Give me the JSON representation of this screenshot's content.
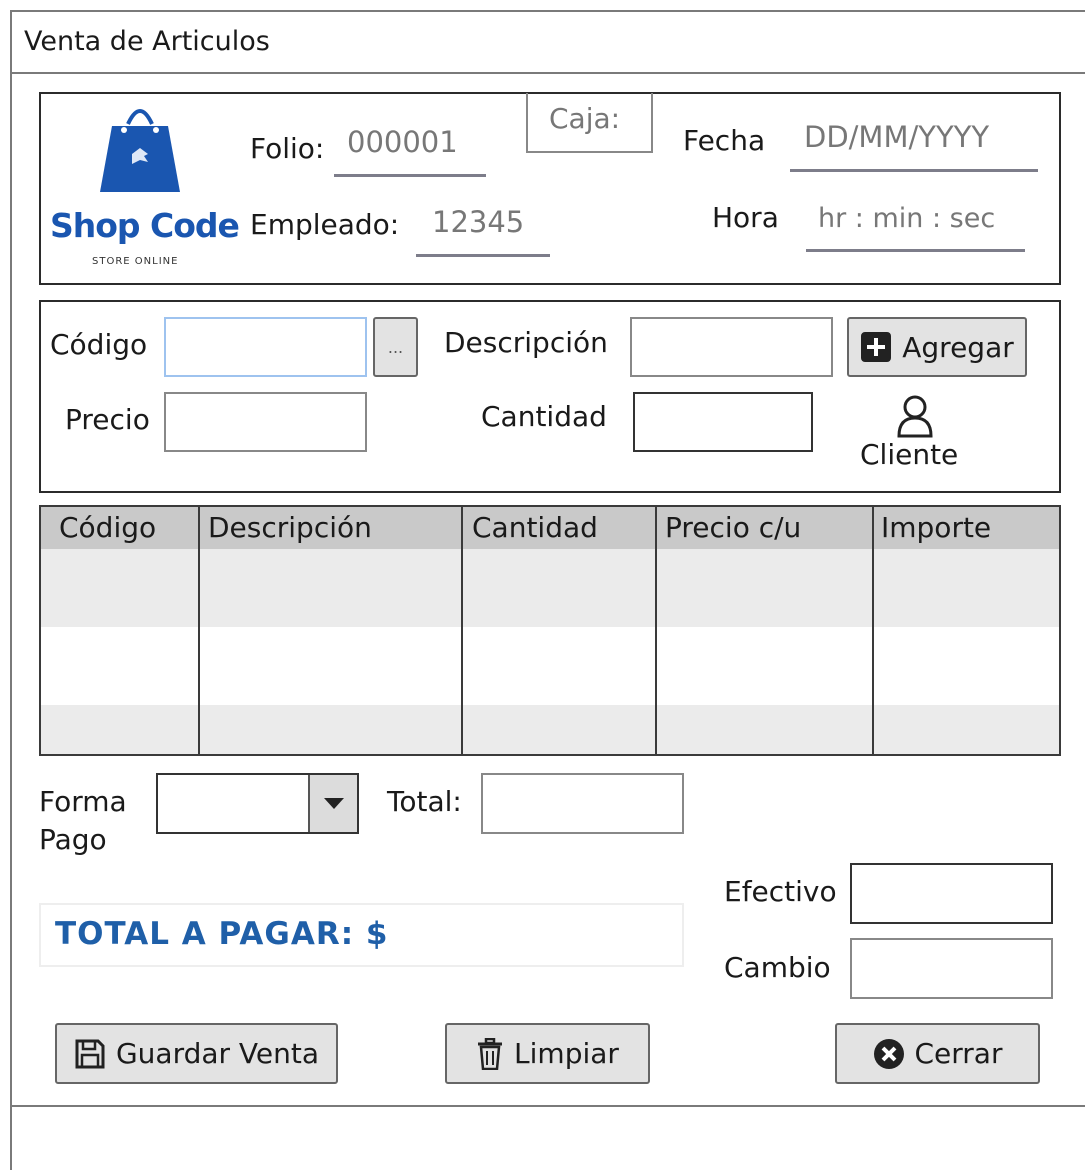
{
  "window": {
    "title": "Venta de Articulos"
  },
  "header": {
    "logo": {
      "brand": "Shop Code",
      "tagline": "STORE ONLINE"
    },
    "folio": {
      "label": "Folio:",
      "value": "000001"
    },
    "empleado": {
      "label": "Empleado:",
      "value": "12345"
    },
    "caja": {
      "label": "Caja:"
    },
    "fecha": {
      "label": "Fecha",
      "value": "DD/MM/YYYY"
    },
    "hora": {
      "label": "Hora",
      "value": "hr : min : sec"
    }
  },
  "entry": {
    "codigo_label": "Código",
    "browse_label": "...",
    "descripcion_label": "Descripción",
    "agregar_label": "Agregar",
    "precio_label": "Precio",
    "cantidad_label": "Cantidad",
    "cliente_label": "Cliente"
  },
  "table": {
    "columns": [
      "Código",
      "Descripción",
      "Cantidad",
      "Precio c/u",
      "Importe"
    ],
    "rows": []
  },
  "payment": {
    "forma_pago_label_1": "Forma",
    "forma_pago_label_2": "Pago",
    "forma_pago_value": "",
    "total_label": "Total:",
    "total_value": "",
    "total_a_pagar": "TOTAL  A PAGAR: $",
    "efectivo_label": "Efectivo",
    "cambio_label": "Cambio"
  },
  "actions": {
    "guardar_label": "Guardar Venta",
    "limpiar_label": "Limpiar",
    "cerrar_label": "Cerrar"
  },
  "colors": {
    "accent": "#1f5fa8",
    "logo": "#1a56b0"
  },
  "icons": [
    "shopping-bag-icon",
    "plus-square-icon",
    "user-icon",
    "chevron-down-icon",
    "floppy-disk-icon",
    "trash-icon",
    "close-circle-icon"
  ]
}
